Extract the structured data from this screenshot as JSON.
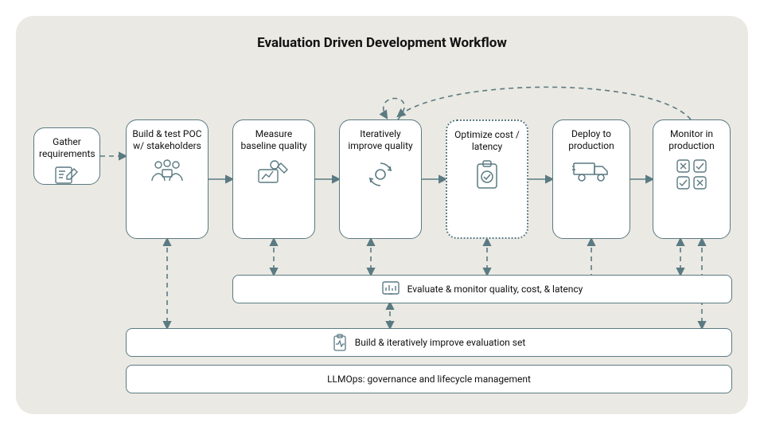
{
  "title": "Evaluation Driven Development Workflow",
  "stages": {
    "gather": {
      "label": "Gather\nrequirements"
    },
    "poc": {
      "label": "Build & test POC w/ stakeholders"
    },
    "baseline": {
      "label": "Measure baseline quality"
    },
    "iterate": {
      "label": "Iteratively improve quality"
    },
    "optimize": {
      "label": "Optimize cost / latency"
    },
    "deploy": {
      "label": "Deploy to production"
    },
    "monitor": {
      "label": "Monitor in production"
    }
  },
  "bands": {
    "evaluate": {
      "label": "Evaluate & monitor quality, cost, & latency"
    },
    "evalset": {
      "label": "Build & iteratively improve evaluation set"
    },
    "llmops": {
      "label": "LLMOps: governance and lifecycle management"
    }
  },
  "chart_data": {
    "type": "flow",
    "title": "Evaluation Driven Development Workflow",
    "nodes": [
      {
        "id": "gather",
        "label": "Gather requirements"
      },
      {
        "id": "poc",
        "label": "Build & test POC w/ stakeholders"
      },
      {
        "id": "baseline",
        "label": "Measure baseline quality"
      },
      {
        "id": "iterate",
        "label": "Iteratively improve quality"
      },
      {
        "id": "optimize",
        "label": "Optimize cost / latency",
        "optional": true
      },
      {
        "id": "deploy",
        "label": "Deploy to production"
      },
      {
        "id": "monitor",
        "label": "Monitor in production"
      },
      {
        "id": "evaluate",
        "label": "Evaluate & monitor quality, cost, & latency",
        "type": "band"
      },
      {
        "id": "evalset",
        "label": "Build & iteratively improve evaluation set",
        "type": "band"
      },
      {
        "id": "llmops",
        "label": "LLMOps: governance and lifecycle management",
        "type": "band"
      }
    ],
    "edges": [
      {
        "from": "gather",
        "to": "poc",
        "style": "dashed"
      },
      {
        "from": "poc",
        "to": "baseline",
        "style": "solid"
      },
      {
        "from": "baseline",
        "to": "iterate",
        "style": "solid"
      },
      {
        "from": "iterate",
        "to": "optimize",
        "style": "solid"
      },
      {
        "from": "optimize",
        "to": "deploy",
        "style": "solid"
      },
      {
        "from": "deploy",
        "to": "monitor",
        "style": "solid"
      },
      {
        "from": "iterate",
        "to": "iterate",
        "style": "dashed",
        "note": "self-loop"
      },
      {
        "from": "monitor",
        "to": "iterate",
        "style": "dashed",
        "note": "feedback loop"
      },
      {
        "from": "poc",
        "to": "evalset",
        "style": "dashed",
        "dir": "both"
      },
      {
        "from": "baseline",
        "to": "evaluate",
        "style": "dashed",
        "dir": "both"
      },
      {
        "from": "iterate",
        "to": "evaluate",
        "style": "dashed",
        "dir": "both"
      },
      {
        "from": "iterate",
        "to": "evalset",
        "style": "dashed",
        "dir": "both"
      },
      {
        "from": "optimize",
        "to": "evaluate",
        "style": "dashed",
        "dir": "both"
      },
      {
        "from": "deploy",
        "to": "evaluate",
        "style": "dashed"
      },
      {
        "from": "evaluate",
        "to": "monitor",
        "style": "dashed",
        "dir": "both"
      },
      {
        "from": "evalset",
        "to": "monitor",
        "style": "dashed",
        "dir": "both"
      }
    ]
  }
}
